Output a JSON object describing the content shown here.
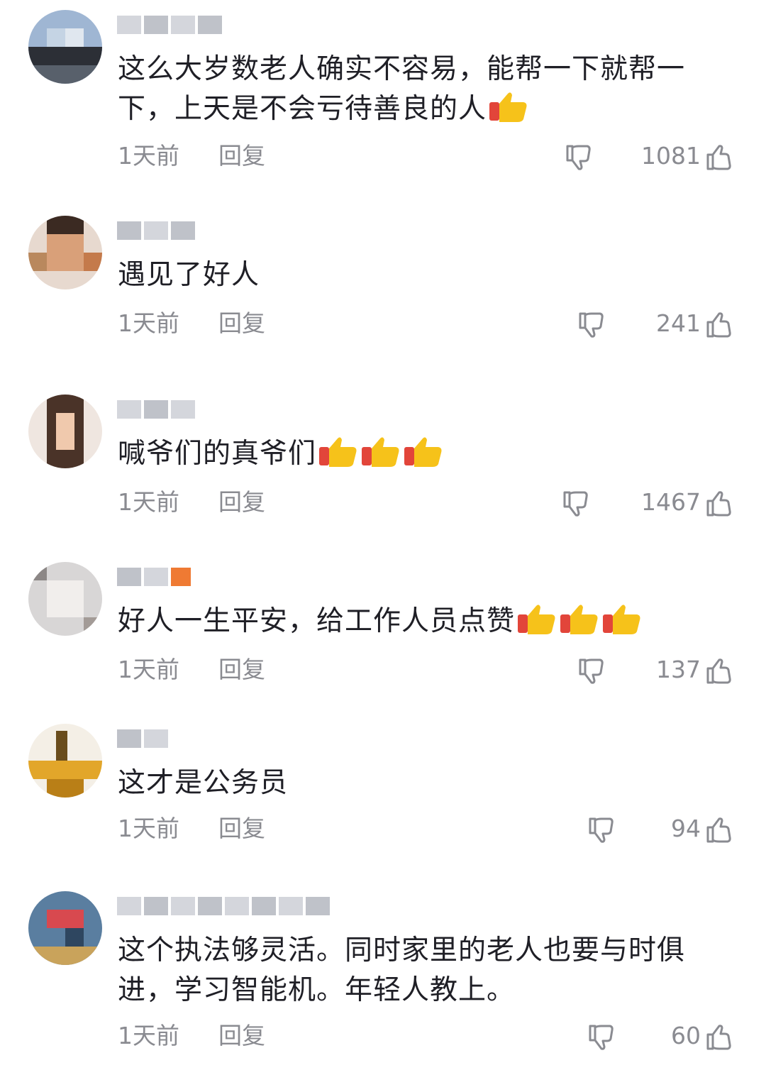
{
  "comments": [
    {
      "text": "这么大岁数老人确实不容易，能帮一下就帮一下，上天是不会亏待善良的人",
      "emoji_count": 1,
      "time": "1天前",
      "reply": "回复",
      "likes": "1081"
    },
    {
      "text": "遇见了好人",
      "emoji_count": 0,
      "time": "1天前",
      "reply": "回复",
      "likes": "241"
    },
    {
      "text": "喊爷们的真爷们",
      "emoji_count": 3,
      "time": "1天前",
      "reply": "回复",
      "likes": "1467"
    },
    {
      "text": "好人一生平安，给工作人员点赞",
      "emoji_count": 3,
      "time": "1天前",
      "reply": "回复",
      "likes": "137"
    },
    {
      "text": "这才是公务员",
      "emoji_count": 0,
      "time": "1天前",
      "reply": "回复",
      "likes": "94"
    },
    {
      "text": "这个执法够灵活。同时家里的老人也要与时俱进，学习智能机。年轻人教上。",
      "emoji_count": 0,
      "time": "1天前",
      "reply": "回复",
      "likes": "60"
    }
  ],
  "icons": {
    "dislike": "thumbs-down-icon",
    "like": "thumbs-up-icon",
    "emoji": "thumbs-up-emoji"
  },
  "colors": {
    "text": "#1f1f26",
    "meta": "#8a8b91",
    "emoji_yellow": "#f6c21a",
    "emoji_cuff": "#e2453a"
  }
}
